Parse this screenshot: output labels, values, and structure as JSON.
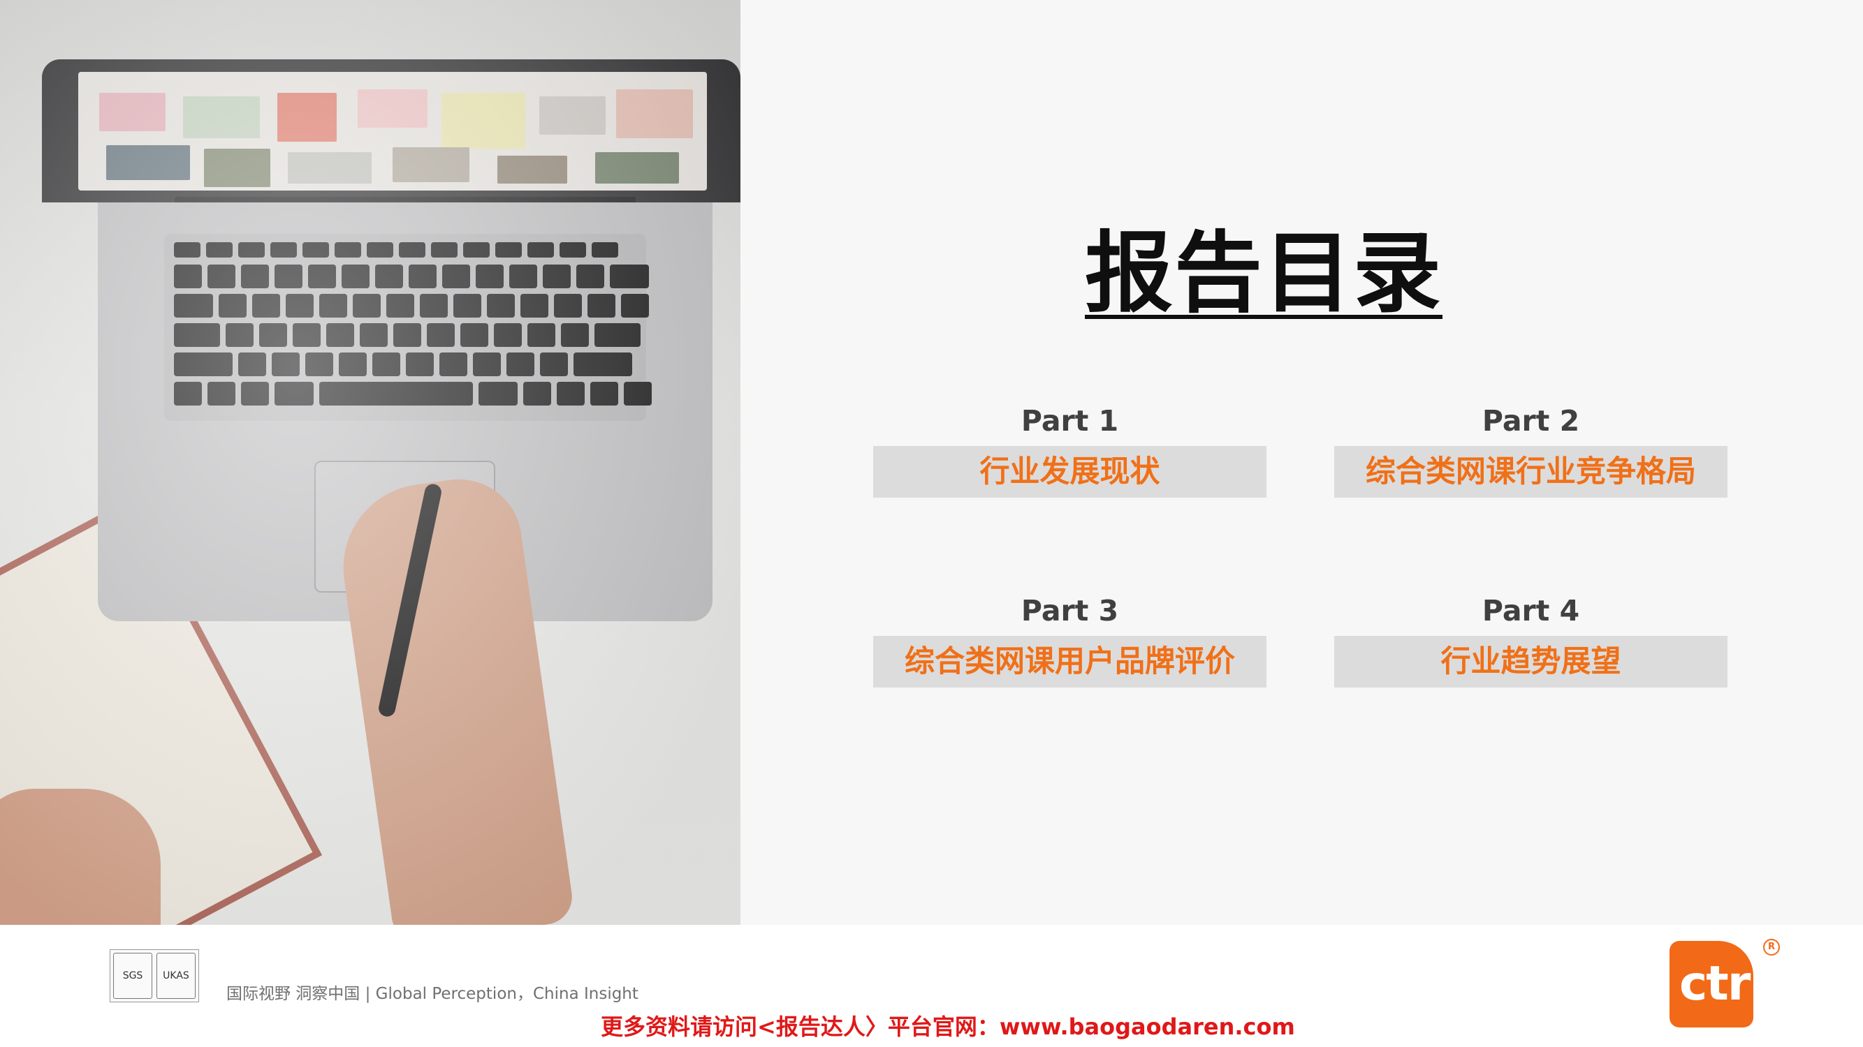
{
  "title": "报告目录",
  "parts": [
    {
      "label": "Part 1",
      "text": "行业发展现状"
    },
    {
      "label": "Part 2",
      "text": "综合类网课行业竞争格局"
    },
    {
      "label": "Part 3",
      "text": "综合类网课用户品牌评价"
    },
    {
      "label": "Part 4",
      "text": "行业趋势展望"
    }
  ],
  "footer": {
    "slogan": "国际视野  洞察中国 | Global Perception，China Insight",
    "promo": "更多资料请访问<报告达人〉平台官网：www.baogaodaren.com",
    "brand": "ctr",
    "cert1": "SGS",
    "cert2": "UKAS",
    "reg": "R"
  },
  "colors": {
    "accent": "#f07018",
    "box_bg": "#dcdcdc",
    "promo": "#e01818",
    "brand": "#f26a17"
  },
  "icons": [
    "sgs-certification-icon",
    "ukas-certification-icon",
    "ctr-logo-icon"
  ]
}
